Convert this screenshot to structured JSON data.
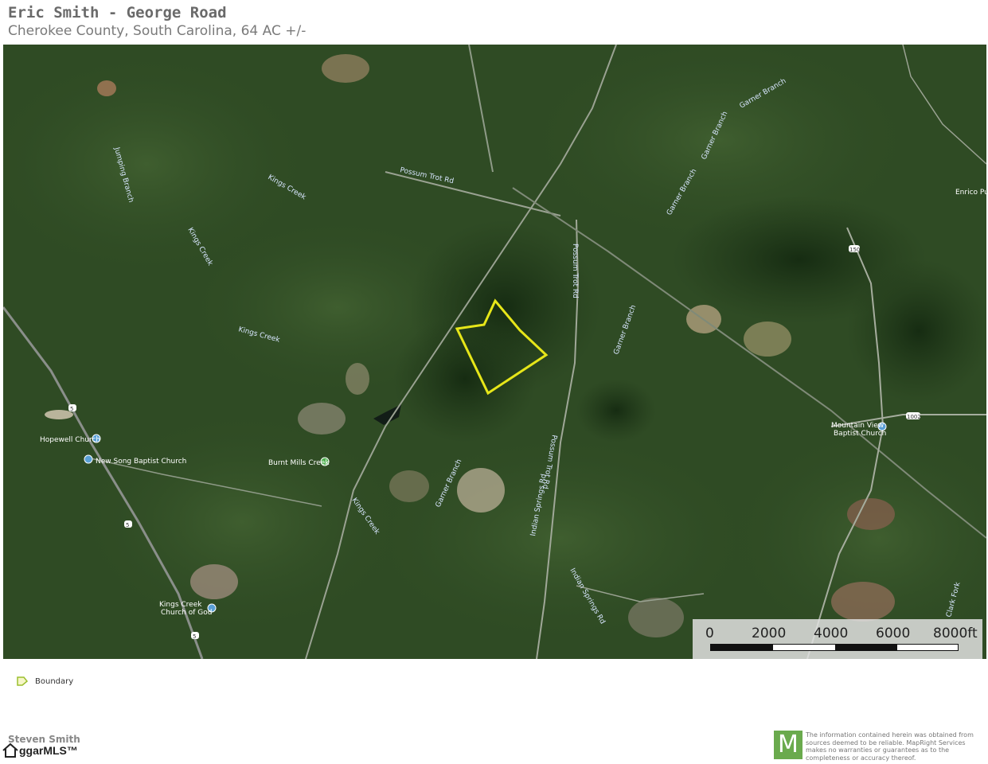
{
  "header": {
    "title": "Eric Smith - George Road",
    "subtitle": "Cherokee County, South Carolina, 64 AC +/-"
  },
  "map": {
    "labels": {
      "possum_trot_rd_1": "Possum Trot Rd",
      "possum_trot_rd_2": "Possum Trot Rd",
      "possum_trot_rd_3": "Possum Trot Rd",
      "kings_creek_1": "Kings Creek",
      "kings_creek_2": "Kings Creek",
      "kings_creek_3": "Kings Creek",
      "kings_creek_4": "Kings Creek",
      "garner_branch_1": "Garner Branch",
      "garner_branch_2": "Garner Branch",
      "garner_branch_3": "Garner Branch",
      "garner_branch_4": "Garner Branch",
      "garner_branch_5": "Garner Branch",
      "indian_springs_rd_1": "Indian Springs Rd",
      "indian_springs_rd_2": "Indian Springs Rd",
      "clark_fork": "Clark Fork",
      "jumping_branch": "Jumping Branch",
      "enrico_pu": "Enrico Pu",
      "hopewell_church": "Hopewell Church",
      "new_song_baptist": "New Song Baptist Church",
      "burnt_mills_creek": "Burnt Mills Creek",
      "mountain_view_1": "Mountain View",
      "mountain_view_2": "Baptist Church",
      "kings_creek_church_1": "Kings Creek",
      "kings_creek_church_2": "Church of God",
      "shield_5_a": "5",
      "shield_5_b": "5",
      "shield_5_c": "5",
      "shield_150": "150",
      "shield_1002": "1002"
    },
    "colors": {
      "boundary": "#e6e619",
      "forest": "#2e4a23",
      "dark_forest": "#1f3618",
      "water": "#1a2a35",
      "clearing": "#9a8f74"
    }
  },
  "scale": {
    "ticks": [
      "0",
      "2000",
      "4000",
      "6000",
      "8000ft"
    ]
  },
  "legend": {
    "boundary_label": "Boundary"
  },
  "footer": {
    "agent_name": "Steven Smith",
    "mls_brand": "ggarMLS™",
    "logo_letter": "M",
    "disclaimer": "The information contained herein was obtained from sources deemed to be reliable. MapRight Services makes no warranties or guarantees as to the completeness or accuracy thereof."
  }
}
